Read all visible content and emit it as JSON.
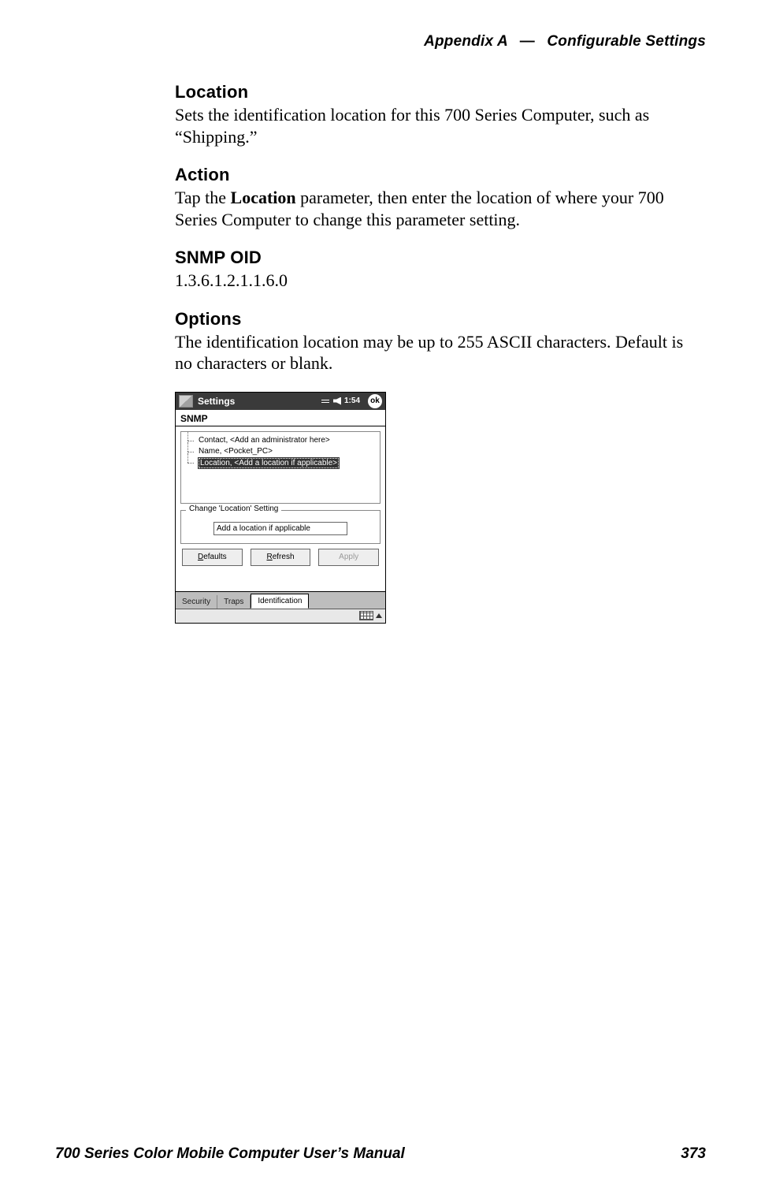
{
  "header": {
    "left": "Appendix A",
    "sep": "—",
    "right": "Configurable Settings"
  },
  "sections": {
    "location": {
      "heading": "Location",
      "body": "Sets the identification location for this 700 Series Computer, such as “Shipping.”"
    },
    "action": {
      "heading": "Action",
      "body_pre": "Tap the ",
      "body_bold": "Location",
      "body_post": " parameter, then enter the location of where your 700 Series Computer to change this parameter setting."
    },
    "snmp": {
      "heading": "SNMP OID",
      "body": "1.3.6.1.2.1.1.6.0"
    },
    "options": {
      "heading": "Options",
      "body": "The identification location may be up to 255 ASCII characters. Default is no characters or blank."
    }
  },
  "screenshot": {
    "titlebar": {
      "title": "Settings",
      "time": "1:54",
      "ok": "ok"
    },
    "app_title": "SNMP",
    "tree": {
      "items": [
        {
          "label": "Contact, <Add an administrator here>",
          "selected": false
        },
        {
          "label": "Name, <Pocket_PC>",
          "selected": false
        },
        {
          "label": "Location, <Add a location if applicable>",
          "selected": true
        }
      ]
    },
    "group": {
      "legend": "Change 'Location' Setting",
      "input_value": "Add a location if applicable"
    },
    "buttons": {
      "defaults": {
        "ul": "D",
        "rest": "efaults",
        "disabled": false
      },
      "refresh": {
        "ul": "R",
        "rest": "efresh",
        "disabled": false
      },
      "apply": {
        "ul": "A",
        "rest": "pply",
        "disabled": true
      }
    },
    "tabs": [
      {
        "label": "Security",
        "active": false
      },
      {
        "label": "Traps",
        "active": false
      },
      {
        "label": "Identification",
        "active": true
      }
    ]
  },
  "footer": {
    "left": "700 Series Color Mobile Computer User’s Manual",
    "right": "373"
  }
}
